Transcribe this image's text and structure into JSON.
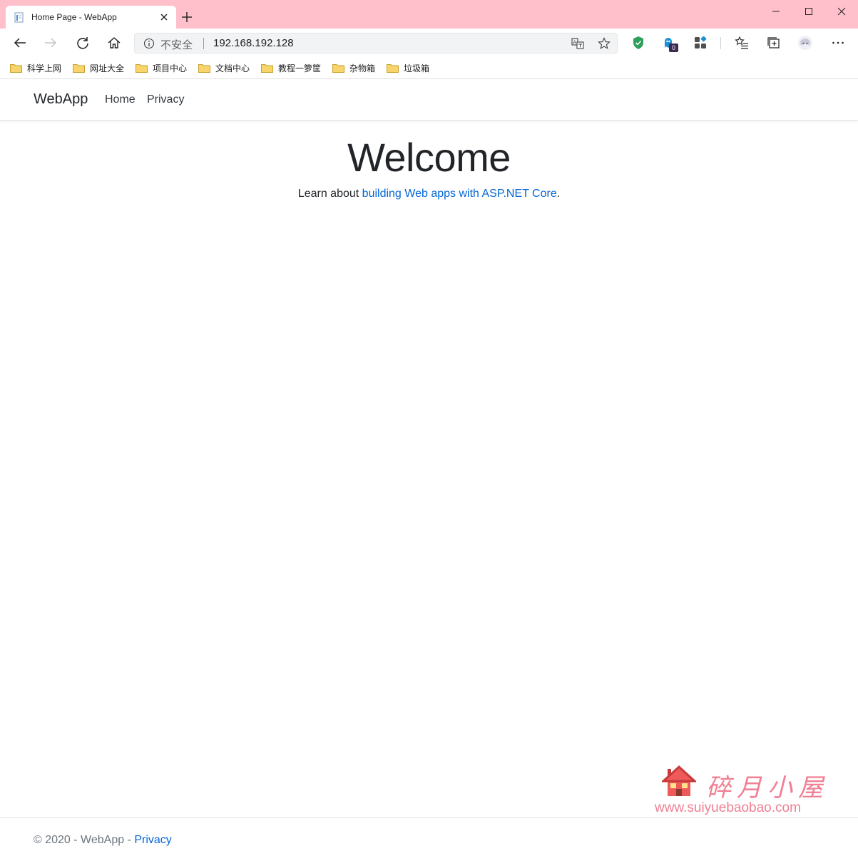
{
  "browser": {
    "tab_title": "Home Page - WebApp",
    "security_label": "不安全",
    "url": "192.168.192.128",
    "extension_badge": "0",
    "bookmarks": [
      "科学上网",
      "网址大全",
      "项目中心",
      "文档中心",
      "教程一箩筐",
      "杂物箱",
      "垃圾箱"
    ],
    "colors": {
      "titlebar": "#ffc0cb",
      "shield": "#2e9e5b"
    }
  },
  "site": {
    "brand": "WebApp",
    "nav": [
      "Home",
      "Privacy"
    ],
    "heading": "Welcome",
    "intro_prefix": "Learn about ",
    "intro_link": "building Web apps with ASP.NET Core",
    "intro_suffix": ".",
    "footer_text": "© 2020 - WebApp - ",
    "footer_link": "Privacy",
    "colors": {
      "link": "#0366d6",
      "text": "#212529"
    }
  },
  "watermark": {
    "text": "碎月小屋",
    "url": "www.suiyuebaobao.com",
    "color": "#f07f93"
  }
}
